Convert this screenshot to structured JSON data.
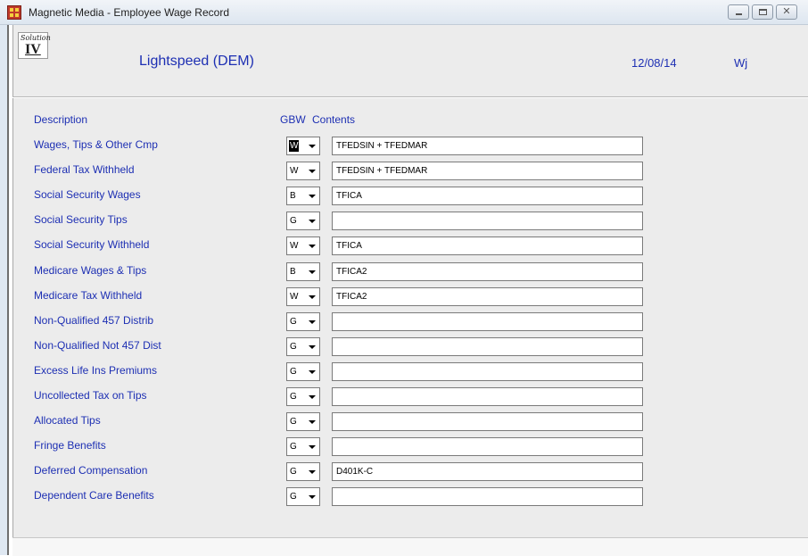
{
  "window": {
    "title": "Magnetic Media - Employee Wage Record",
    "close_glyph": "✕"
  },
  "header": {
    "logo_script": "Solution",
    "logo_numeral": "IV",
    "company": "Lightspeed (DEM)",
    "date": "12/08/14",
    "user": "Wj"
  },
  "columns": {
    "description": "Description",
    "gbw": "GBW",
    "contents": "Contents"
  },
  "rows": [
    {
      "label": "Wages, Tips & Other Cmp",
      "gbw": "W",
      "contents": "TFEDSIN + TFEDMAR"
    },
    {
      "label": "Federal Tax Withheld",
      "gbw": "W",
      "contents": "TFEDSIN + TFEDMAR"
    },
    {
      "label": "Social Security Wages",
      "gbw": "B",
      "contents": "TFICA"
    },
    {
      "label": "Social Security Tips",
      "gbw": "G",
      "contents": ""
    },
    {
      "label": "Social Security Withheld",
      "gbw": "W",
      "contents": "TFICA"
    },
    {
      "label": "Medicare Wages & Tips",
      "gbw": "B",
      "contents": "TFICA2"
    },
    {
      "label": "Medicare Tax Withheld",
      "gbw": "W",
      "contents": "TFICA2"
    },
    {
      "label": "Non-Qualified 457 Distrib",
      "gbw": "G",
      "contents": ""
    },
    {
      "label": "Non-Qualified Not 457 Dist",
      "gbw": "G",
      "contents": ""
    },
    {
      "label": "Excess Life Ins Premiums",
      "gbw": "G",
      "contents": ""
    },
    {
      "label": "Uncollected Tax on Tips",
      "gbw": "G",
      "contents": ""
    },
    {
      "label": "Allocated Tips",
      "gbw": "G",
      "contents": ""
    },
    {
      "label": "Fringe Benefits",
      "gbw": "G",
      "contents": ""
    },
    {
      "label": "Deferred Compensation",
      "gbw": "G",
      "contents": "D401K-C"
    },
    {
      "label": "Dependent Care Benefits",
      "gbw": "G",
      "contents": ""
    }
  ]
}
